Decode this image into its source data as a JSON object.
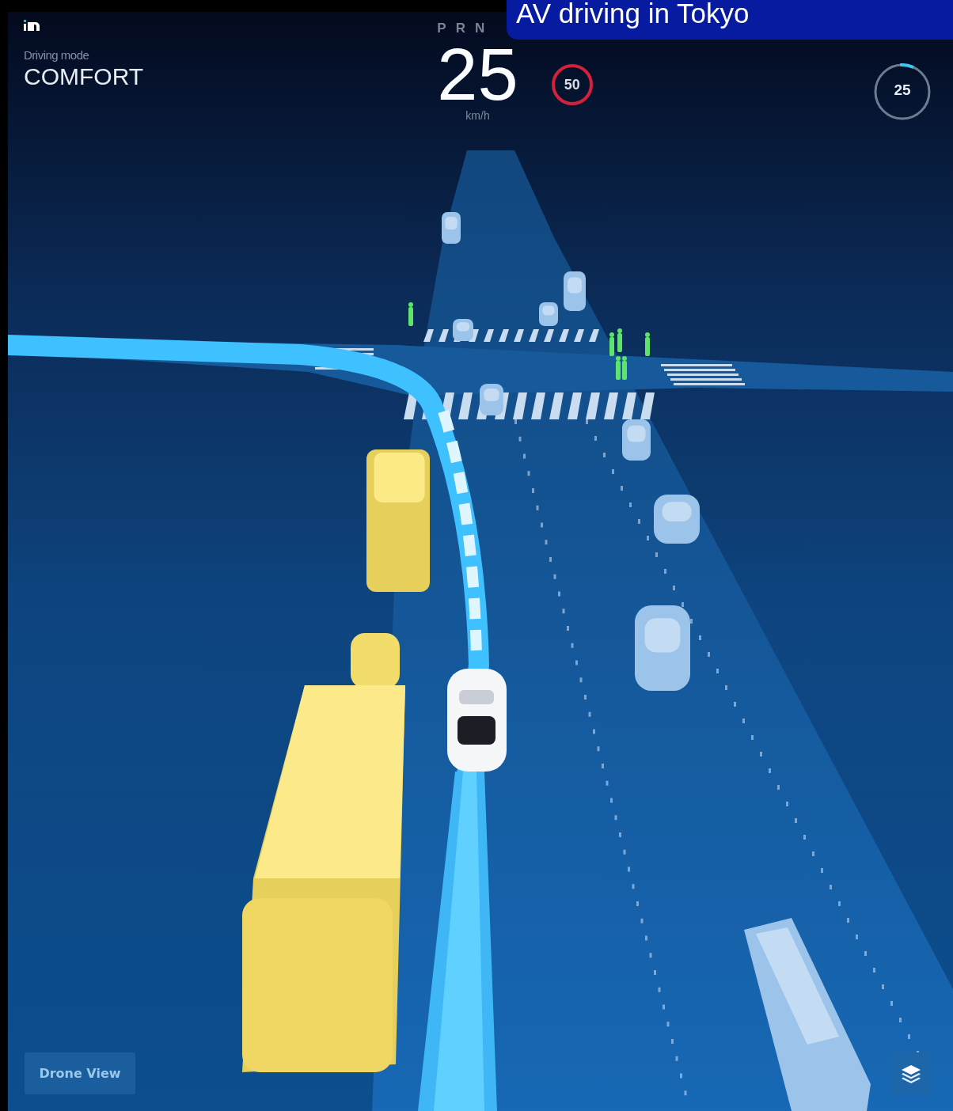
{
  "caption": "AV driving in Tokyo",
  "driving_mode": {
    "label": "Driving mode",
    "value": "COMFORT"
  },
  "gear_selector": [
    {
      "label": "P",
      "selected": false
    },
    {
      "label": "R",
      "selected": false
    },
    {
      "label": "N",
      "selected": false
    }
  ],
  "speed": {
    "value": "25",
    "unit": "km/h"
  },
  "speed_limit": "50",
  "set_speed": {
    "value": "25"
  },
  "buttons": [
    {
      "label": "Drone View"
    }
  ]
}
